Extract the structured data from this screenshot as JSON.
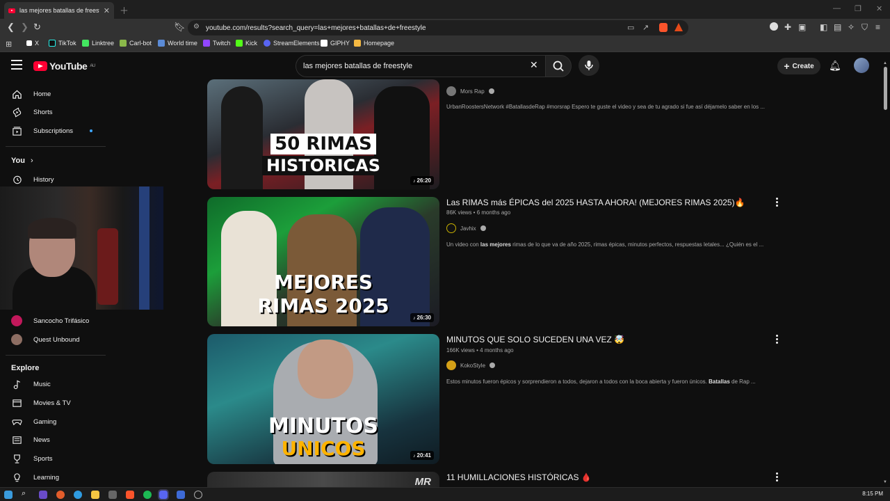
{
  "browser": {
    "tab_title": "las mejores batallas de freestyle",
    "url": "youtube.com/results?search_query=las+mejores+batallas+de+freestyle",
    "bookmarks": [
      {
        "label": "X",
        "color": "#ffffff"
      },
      {
        "label": "TikTok",
        "color": "#25f4ee"
      },
      {
        "label": "Linktree",
        "color": "#43e660"
      },
      {
        "label": "Carl-bot",
        "color": "#8ab84a"
      },
      {
        "label": "World time",
        "color": "#5b8bd6"
      },
      {
        "label": "Twitch",
        "color": "#9146ff"
      },
      {
        "label": "Kick",
        "color": "#53fc18"
      },
      {
        "label": "StreamElements",
        "color": "#5865f2"
      },
      {
        "label": "GIPHY",
        "color": "#ffffff"
      },
      {
        "label": "Homepage",
        "color": "#f5b942"
      }
    ]
  },
  "header": {
    "logo": "YouTube",
    "region": "AU",
    "search_value": "las mejores batallas de freestyle",
    "create_label": "Create"
  },
  "sidebar": {
    "main": [
      {
        "label": "Home",
        "icon": "home-icon"
      },
      {
        "label": "Shorts",
        "icon": "shorts-icon"
      },
      {
        "label": "Subscriptions",
        "icon": "subscriptions-icon"
      }
    ],
    "you_label": "You",
    "history_label": "History",
    "subscriptions": [
      {
        "label": "Sancocho Trifásico",
        "color": "#c2185b"
      },
      {
        "label": "Quest Unbound",
        "color": "#8d6e63"
      }
    ],
    "explore_label": "Explore",
    "explore": [
      {
        "label": "Music",
        "icon": "music-icon"
      },
      {
        "label": "Movies & TV",
        "icon": "movies-icon"
      },
      {
        "label": "Gaming",
        "icon": "gaming-icon"
      },
      {
        "label": "News",
        "icon": "news-icon"
      },
      {
        "label": "Sports",
        "icon": "sports-icon"
      },
      {
        "label": "Learning",
        "icon": "learning-icon"
      }
    ]
  },
  "results": [
    {
      "thumb_text_1": "50 RIMAS",
      "thumb_text_2": "HISTORICAS",
      "duration": "26:20",
      "channel": "Mors Rap",
      "description": "UrbanRoostersNetwork #BatallasdeRap #morsrap Espero te guste el video y sea de tu agrado si fue así déjamelo saber en los ..."
    },
    {
      "title": "Las RIMAS más ÉPICAS del 2025 HASTA AHORA! (MEJORES RIMAS 2025)🔥",
      "meta": "86K views • 6 months ago",
      "channel": "Javhix",
      "description_pre": "Un video con ",
      "description_bold": "las mejores",
      "description_post": " rimas de lo que va de año 2025, rimas épicas, minutos perfectos, respuestas letales... ¿Quién es el ...",
      "thumb_text_1": "MEJORES",
      "thumb_text_2": "RIMAS 2025",
      "duration": "26:30"
    },
    {
      "title": "MINUTOS QUE SOLO SUCEDEN UNA VEZ 🤯",
      "meta": "166K views • 4 months ago",
      "channel": "KokoStyle",
      "description_pre": "Estos minutos fueron épicos y sorprendieron a todos, dejaron a todos con la boca abierta y fueron únicos. ",
      "description_bold": "Batallas",
      "description_post": " de Rap ...",
      "thumb_text_1": "MINUTOS",
      "thumb_text_2": "UNICOS",
      "duration": "20:41"
    },
    {
      "title": "11 HUMILLACIONES HISTÓRICAS 🩸",
      "thumb_text_1": "MR"
    }
  ],
  "taskbar": {
    "clock": "8:15 PM"
  }
}
